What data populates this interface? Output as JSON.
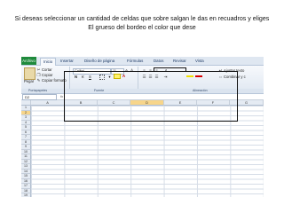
{
  "caption": {
    "line1": "Si deseas seleccionar un cantidad de celdas que sobre salgan le das en recuadros y eliges",
    "line2": "El grueso del bordeo el color que dese"
  },
  "excel": {
    "tabs": [
      "Archivo",
      "Inicio",
      "Insertar",
      "Diseño de página",
      "Fórmulas",
      "Datos",
      "Revisar",
      "Vista"
    ],
    "active_tab": "Inicio",
    "ribbon": {
      "paste_label": "Pegar",
      "cut_label": "Cortar",
      "copy_label": "Copiar",
      "format_painter_label": "Copiar formato",
      "font_name": "Calibri",
      "font_size": "11",
      "bold": "N",
      "italic": "K",
      "underline": "S",
      "wrap_text_label": "Ajustar texto",
      "merge_label": "Combinar y c",
      "groups": [
        "Portapapeles",
        "Fuente",
        "Alineación"
      ]
    },
    "name_box": "D2",
    "fx_label": "fx",
    "columns": [
      "A",
      "B",
      "C",
      "D",
      "E",
      "F",
      "G"
    ],
    "selected_column": "D",
    "rows": [
      "1",
      "2",
      "3",
      "4",
      "5",
      "6",
      "7",
      "8",
      "9",
      "10",
      "11",
      "12",
      "13",
      "14",
      "15",
      "16",
      "17",
      "18",
      "19",
      "20"
    ],
    "selected_row": "2",
    "colors": {
      "file_tab": "#1f8a3c",
      "selection_header": "#f7d58a",
      "highlight_fill": "#f0e000",
      "font_color": "#d60000"
    }
  }
}
